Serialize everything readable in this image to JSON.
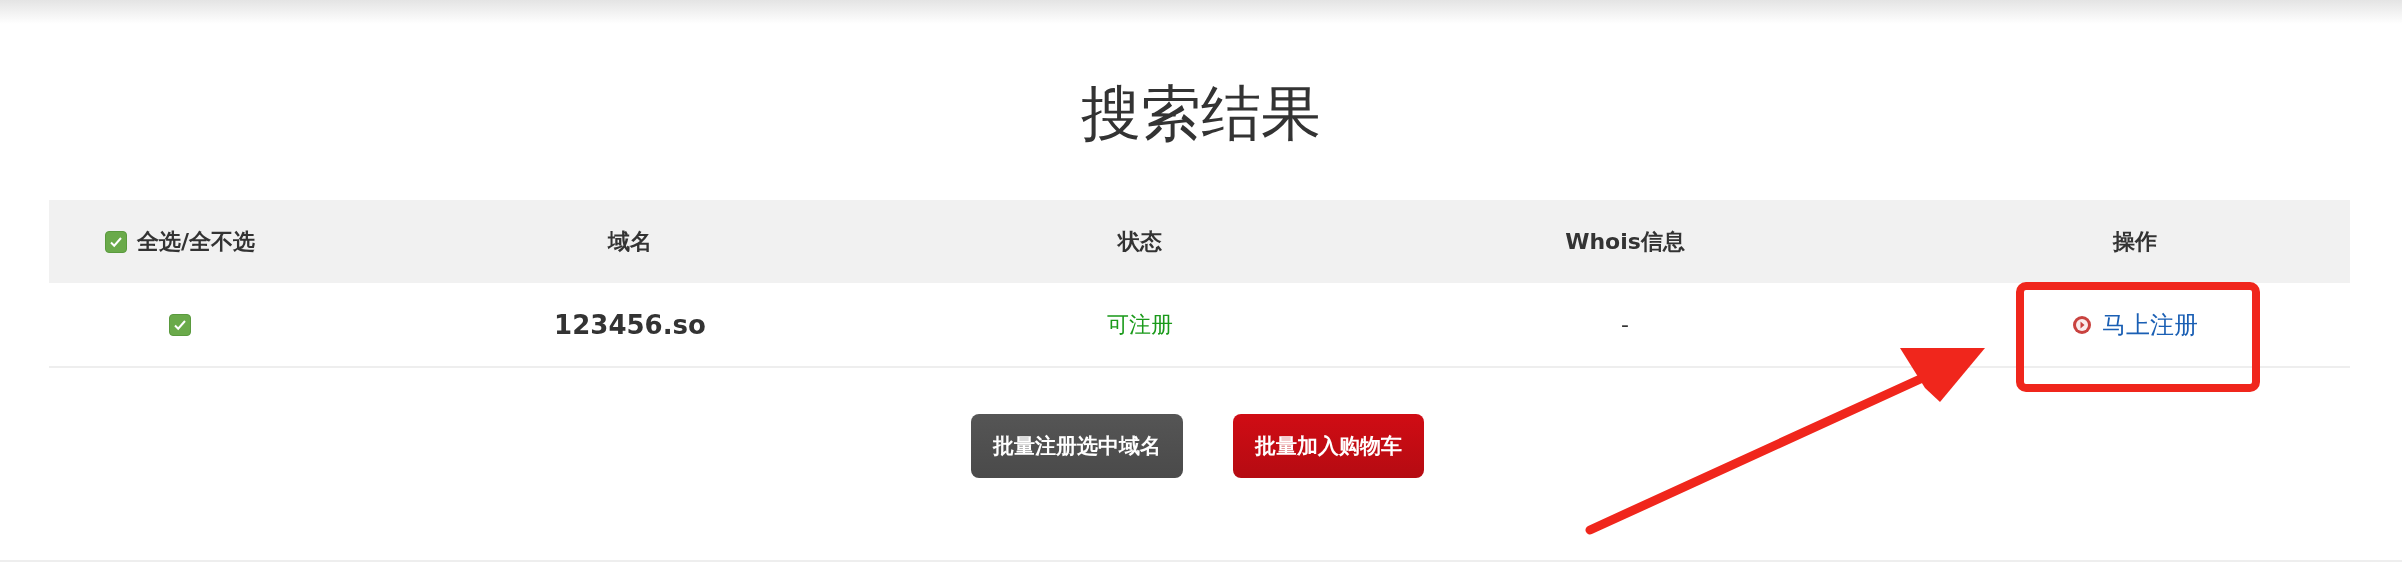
{
  "title": "搜索结果",
  "table": {
    "select_all": {
      "label": "全选/全不选",
      "checked": true
    },
    "columns": [
      "域名",
      "状态",
      "Whois信息",
      "操作"
    ],
    "rows": [
      {
        "checked": true,
        "domain": "123456.so",
        "status": "可注册",
        "whois": "-",
        "action": "马上注册"
      }
    ]
  },
  "buttons": [
    {
      "label": "批量注册选中域名",
      "kind": "dark"
    },
    {
      "label": "批量加入购物车",
      "kind": "red"
    }
  ]
}
